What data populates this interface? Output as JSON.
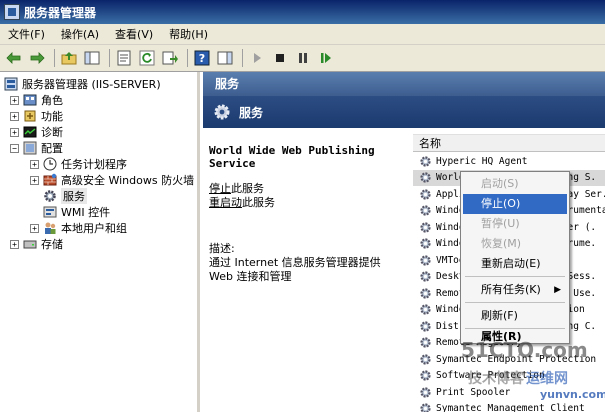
{
  "window": {
    "title": "服务器管理器"
  },
  "menubar": [
    "文件(F)",
    "操作(A)",
    "查看(V)",
    "帮助(H)"
  ],
  "tree": {
    "root": "服务器管理器 (IIS-SERVER)",
    "items": [
      {
        "label": "角色",
        "expander": "+"
      },
      {
        "label": "功能",
        "expander": "+"
      },
      {
        "label": "诊断",
        "expander": "+"
      },
      {
        "label": "配置",
        "expander": "−"
      },
      {
        "label": "任务计划程序",
        "expander": "+"
      },
      {
        "label": "高级安全 Windows 防火墙",
        "expander": "+"
      },
      {
        "label": "服务",
        "expander": ""
      },
      {
        "label": "WMI 控件",
        "expander": ""
      },
      {
        "label": "本地用户和组",
        "expander": "+"
      },
      {
        "label": "存储",
        "expander": "+"
      }
    ]
  },
  "content": {
    "header": "服务",
    "subheader": "服务",
    "service_name": "World Wide Web Publishing Service",
    "action_stop_link": "停止",
    "action_stop_rest": "此服务",
    "action_restart_link": "重启动",
    "action_restart_rest": "此服务",
    "desc_label": "描述:",
    "desc_text": "通过 Internet 信息服务管理器提供 Web 连接和管理"
  },
  "list": {
    "column_name": "名称",
    "rows": [
      "Hyperic HQ Agent",
      "World Wide Web Publishing S.",
      "Application Layer Gateway Ser.",
      "Windows Management Instrumentation",
      "Windows Modules Installer (.",
      "Windows Management Instrume.",
      "VMTools",
      "Desktop Window Manager Sess.",
      "Remote Access Auto Conn Use.",
      "Windows Process Activation",
      "Distributed Link Tracking C.",
      "Remote Registry",
      "Symantec Endpoint Protection",
      "Software Protection",
      "Print Spooler",
      "Symantec Management Client"
    ]
  },
  "context_menu": {
    "items": [
      {
        "label": "启动(S)",
        "state": "disabled"
      },
      {
        "label": "停止(O)",
        "state": "active"
      },
      {
        "label": "暂停(U)",
        "state": "disabled"
      },
      {
        "label": "恢复(M)",
        "state": "disabled"
      },
      {
        "label": "重新启动(E)",
        "state": "normal"
      },
      {
        "label": "所有任务(K)",
        "state": "submenu"
      },
      {
        "label": "刷新(F)",
        "state": "normal"
      },
      {
        "label": "属性(R)",
        "state": "bold"
      }
    ]
  },
  "watermark": {
    "brand": "51CTO.com",
    "blog": "技术博客",
    "cn": "运维网",
    "url": "yunvn.com"
  },
  "colors": {
    "title_bar": "#0a246a",
    "menu_highlight": "#316ac5",
    "content_header": "#3d5d8f"
  }
}
